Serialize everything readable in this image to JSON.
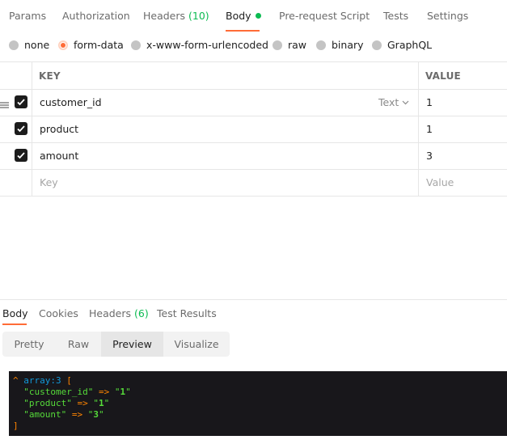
{
  "request_tabs": [
    {
      "label": "Params"
    },
    {
      "label": "Authorization"
    },
    {
      "label": "Headers",
      "count": "(10)"
    },
    {
      "label": "Body"
    },
    {
      "label": "Pre-request Script"
    },
    {
      "label": "Tests"
    },
    {
      "label": "Settings"
    }
  ],
  "body_types": [
    {
      "label": "none"
    },
    {
      "label": "form-data",
      "selected": true
    },
    {
      "label": "x-www-form-urlencoded"
    },
    {
      "label": "raw"
    },
    {
      "label": "binary"
    },
    {
      "label": "GraphQL"
    }
  ],
  "table": {
    "headers": {
      "key": "KEY",
      "value": "VALUE"
    },
    "rows": [
      {
        "key": "customer_id",
        "value": "1",
        "type": "Text",
        "checked": true
      },
      {
        "key": "product",
        "value": "1",
        "checked": true
      },
      {
        "key": "amount",
        "value": "3",
        "checked": true
      }
    ],
    "new_row": {
      "key_placeholder": "Key",
      "value_placeholder": "Value"
    }
  },
  "response_tabs": [
    {
      "label": "Body"
    },
    {
      "label": "Cookies"
    },
    {
      "label": "Headers",
      "count": "(6)"
    },
    {
      "label": "Test Results"
    }
  ],
  "view_modes": [
    {
      "label": "Pretty"
    },
    {
      "label": "Raw"
    },
    {
      "label": "Preview",
      "active": true
    },
    {
      "label": "Visualize"
    }
  ],
  "preview": {
    "caret": "^",
    "type": "array:3",
    "open": "[",
    "close": "]",
    "arrow": "=>",
    "entries": [
      {
        "key": "customer_id",
        "value": "1"
      },
      {
        "key": "product",
        "value": "1"
      },
      {
        "key": "amount",
        "value": "3"
      }
    ]
  },
  "colors": {
    "accent": "#ff6c37",
    "success": "#0cbb52",
    "preview_bg": "#18171b"
  }
}
